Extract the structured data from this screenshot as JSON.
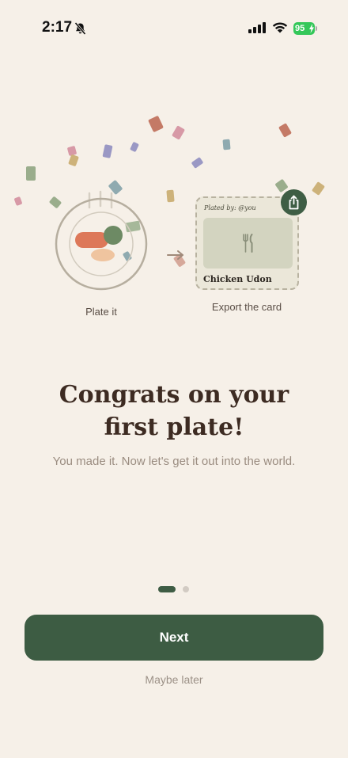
{
  "status_bar": {
    "time": "2:17",
    "battery": "95"
  },
  "illustration": {
    "plate_caption": "Plate it",
    "card_caption": "Export the card",
    "card": {
      "plated_by": "Plated by: @you",
      "dish_name": "Chicken Udon"
    }
  },
  "headline": {
    "line1": "Congrats on your",
    "line2": "first plate!"
  },
  "subtitle": "You made it. Now let's get it out into the world.",
  "pagination": {
    "current": 1,
    "total": 2
  },
  "actions": {
    "next_label": "Next",
    "maybe_later_label": "Maybe later"
  },
  "colors": {
    "background": "#f6f0e8",
    "primary_green": "#3d5c43",
    "headline_text": "#3d2b22",
    "battery_green": "#34c759"
  }
}
